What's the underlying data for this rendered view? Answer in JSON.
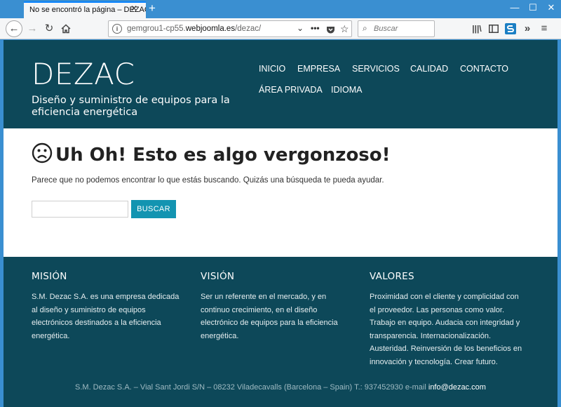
{
  "browser": {
    "tab_title": "No se encontró la página – DEZAC",
    "url_prefix": "gemgrou1-cp55.",
    "url_domain": "webjoomla.es",
    "url_path": "/dezac/",
    "search_placeholder": "Buscar"
  },
  "header": {
    "brand": "DEZAC",
    "tagline": "Diseño y suministro de equipos para la eficiencia energética",
    "nav": [
      "INICIO",
      "EMPRESA",
      "SERVICIOS",
      "CALIDAD",
      "CONTACTO",
      "ÁREA PRIVADA",
      "IDIOMA"
    ]
  },
  "error": {
    "title": "Uh Oh! Esto es algo vergonzoso!",
    "message": "Parece que no podemos encontrar lo que estás buscando. Quizás una búsqueda te pueda ayudar.",
    "search_value": "",
    "search_button": "BUSCAR"
  },
  "footer": {
    "columns": [
      {
        "title": "MISIÓN",
        "text": "S.M. Dezac S.A. es una empresa dedicada al diseño y suministro de equipos electrónicos destinados a la eficiencia energética."
      },
      {
        "title": "VISIÓN",
        "text": "Ser un referente en el mercado, y en continuo crecimiento, en el diseño electrónico de equipos para la eficiencia energética."
      },
      {
        "title": "VALORES",
        "text": "Proximidad con el cliente y complicidad con el proveedor. Las personas como valor. Trabajo en equipo. Audacia con integridad y transparencia. Internacionalización. Austeridad. Reinversión de los beneficios en innovación y tecnología. Crear futuro."
      }
    ],
    "copyright": "S.M. Dezac S.A. – Vial Sant Jordi S/N – 08232 Viladecavalls (Barcelona – Spain) T.: 937452930 e-mail",
    "email": "info@dezac.com"
  },
  "colors": {
    "header_bg": "#0d4859",
    "accent": "#1394b1",
    "chrome": "#3a8fd1"
  }
}
